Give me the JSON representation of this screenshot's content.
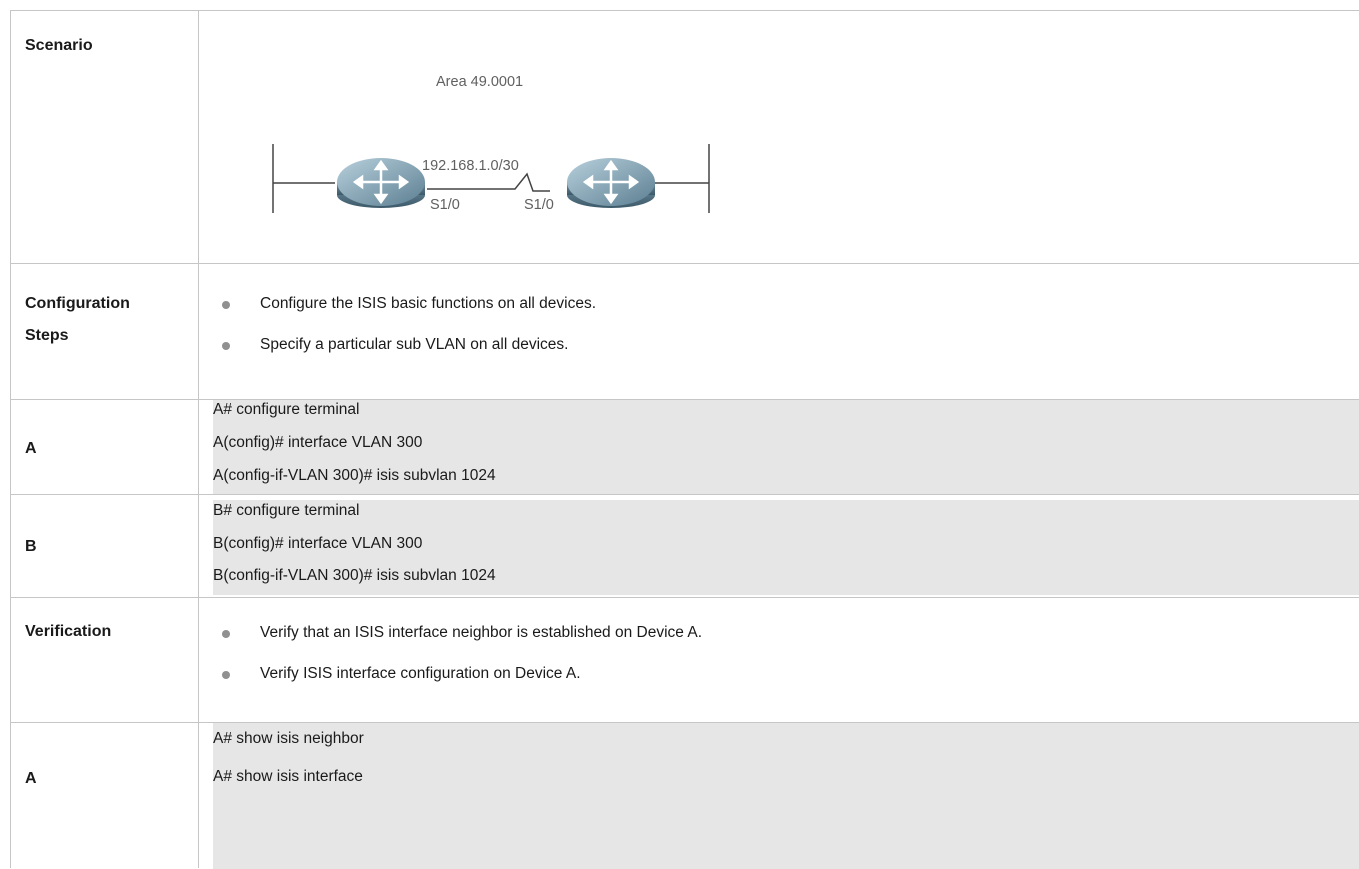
{
  "scenario": {
    "label": "Scenario",
    "diagram": {
      "area_label": "Area 49.0001",
      "link_label": "192.168.1.0/30",
      "left_port": "S1/0",
      "right_port": "S1/0",
      "router_icon": "router-icon"
    }
  },
  "configuration": {
    "label_line1": "Configuration",
    "label_line2": "Steps",
    "bullets": [
      "Configure the ISIS basic functions on all devices.",
      "Specify a particular sub VLAN on all devices."
    ]
  },
  "device_a_config": {
    "label": "A",
    "lines": [
      "A# configure terminal",
      "A(config)# interface VLAN 300",
      "A(config-if-VLAN 300)# isis subvlan 1024"
    ]
  },
  "device_b_config": {
    "label": "B",
    "lines": [
      "B# configure terminal",
      "B(config)# interface VLAN 300",
      "B(config-if-VLAN 300)# isis subvlan 1024"
    ]
  },
  "verification": {
    "label": "Verification",
    "bullets": [
      "Verify that an ISIS interface neighbor is established on Device A.",
      "Verify ISIS interface configuration on Device A."
    ]
  },
  "device_a_verify": {
    "label": "A",
    "lines": [
      "A# show isis neighbor",
      "A# show isis interface"
    ]
  }
}
